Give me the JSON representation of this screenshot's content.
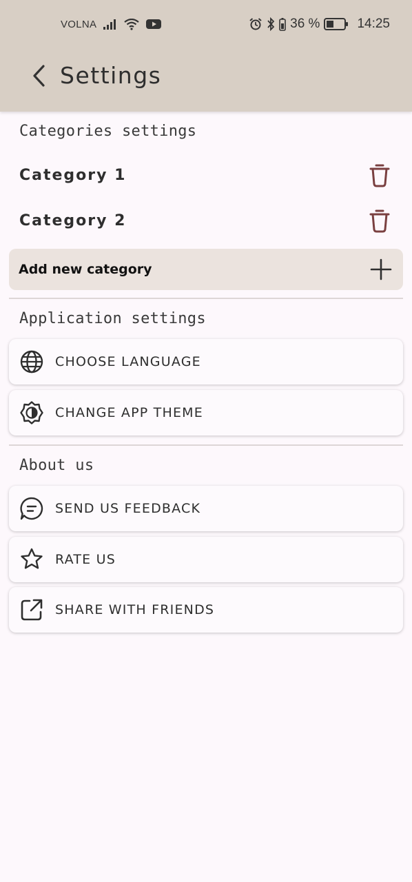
{
  "status_bar": {
    "carrier": "VOLNA",
    "battery": "36 %",
    "time": "14:25"
  },
  "app_bar": {
    "title": "Settings"
  },
  "categories": {
    "section_title": "Categories settings",
    "items": [
      {
        "label": "Category 1"
      },
      {
        "label": "Category 2"
      }
    ],
    "add_label": "Add new category"
  },
  "application": {
    "section_title": "Application settings",
    "items": [
      {
        "label": "CHOOSE LANGUAGE",
        "icon": "globe-icon"
      },
      {
        "label": "CHANGE APP THEME",
        "icon": "theme-icon"
      }
    ]
  },
  "about": {
    "section_title": "About us",
    "items": [
      {
        "label": "SEND US FEEDBACK",
        "icon": "chat-icon"
      },
      {
        "label": "RATE US",
        "icon": "star-icon"
      },
      {
        "label": "SHARE WITH FRIENDS",
        "icon": "share-icon"
      }
    ]
  },
  "colors": {
    "header": "#d8cfc5",
    "background": "#fdf8fc",
    "trash": "#7a4040",
    "add_row": "#ebe3de"
  }
}
